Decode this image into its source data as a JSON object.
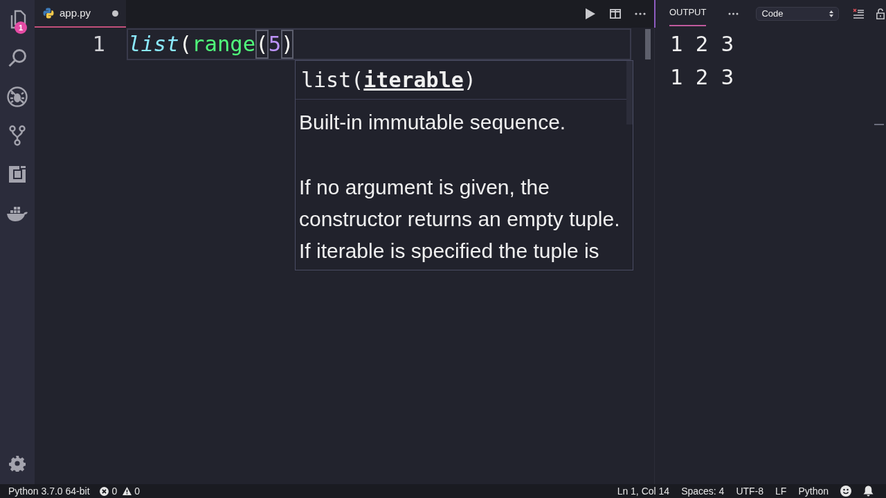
{
  "activity_bar": {
    "items": [
      {
        "kind": "files",
        "badge": "1"
      },
      {
        "kind": "search"
      },
      {
        "kind": "debug"
      },
      {
        "kind": "source_control"
      },
      {
        "kind": "remote"
      },
      {
        "kind": "docker"
      }
    ],
    "bottom_items": [
      {
        "kind": "settings"
      }
    ]
  },
  "editor": {
    "tabs": [
      {
        "label": "app.py",
        "selected": true,
        "modified": true
      }
    ],
    "lines": [
      {
        "number": "1",
        "current": true,
        "tokens": [
          {
            "text": "list",
            "kind": "builtin",
            "matched": false
          },
          {
            "text": "(",
            "kind": "bracket",
            "matched": false
          },
          {
            "text": "range",
            "kind": "function",
            "matched": false
          },
          {
            "text": "(",
            "kind": "bracket",
            "matched": true
          },
          {
            "text": "5",
            "kind": "number",
            "matched": false
          },
          {
            "text": ")",
            "kind": "bracket",
            "matched": true
          }
        ]
      }
    ],
    "hover": {
      "signature": "list(**iterable**)",
      "paragraphs": [
        "Built-in immutable sequence.",
        "If no argument is given, the constructor returns an empty tuple. If iterable is specified the tuple is"
      ]
    }
  },
  "output_panel": {
    "tabs": [
      {
        "label": "OUTPUT",
        "selected": true
      }
    ],
    "channel": "Code",
    "lines": [
      "1 2 3",
      "1 2 3"
    ]
  },
  "status_bar": {
    "left": [
      {
        "kind": "text",
        "text": "Python 3.7.0 64-bit"
      },
      {
        "kind": "errors",
        "text": "0"
      },
      {
        "kind": "warnings",
        "text": "0"
      }
    ],
    "right": [
      "Ln 1, Col 14",
      "Spaces: 4",
      "UTF-8",
      "LF",
      "Python"
    ]
  }
}
